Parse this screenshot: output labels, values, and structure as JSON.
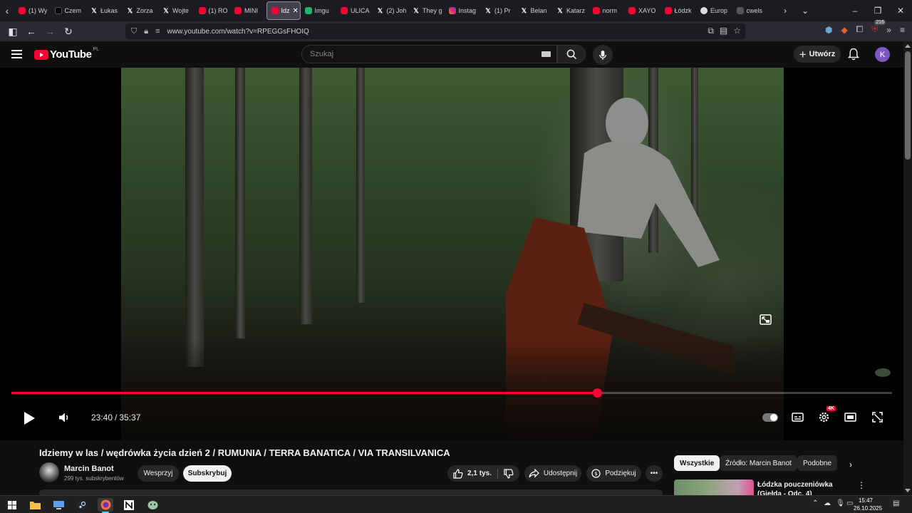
{
  "browser": {
    "tabs": [
      {
        "label": "(1) Wy",
        "favicon": "youtube-icon",
        "active": false
      },
      {
        "label": "Czem",
        "favicon": "tiktok-icon",
        "active": false
      },
      {
        "label": "Łukas",
        "favicon": "x-icon",
        "active": false
      },
      {
        "label": "Zorza",
        "favicon": "x-icon",
        "active": false
      },
      {
        "label": "Wojte",
        "favicon": "x-icon",
        "active": false
      },
      {
        "label": "(1) RO",
        "favicon": "youtube-icon",
        "active": false
      },
      {
        "label": "MINI",
        "favicon": "youtube-icon",
        "active": false
      },
      {
        "label": "Idz",
        "favicon": "youtube-icon",
        "active": true
      },
      {
        "label": "Imgu",
        "favicon": "imgur-icon",
        "active": false
      },
      {
        "label": "ULICA",
        "favicon": "youtube-icon",
        "active": false
      },
      {
        "label": "(2) Joh",
        "favicon": "x-icon",
        "active": false
      },
      {
        "label": "They g",
        "favicon": "x-icon",
        "active": false
      },
      {
        "label": "Instag",
        "favicon": "instagram-icon",
        "active": false
      },
      {
        "label": "(1) Pr",
        "favicon": "x-icon",
        "active": false
      },
      {
        "label": "Belan",
        "favicon": "x-icon",
        "active": false
      },
      {
        "label": "Katarz",
        "favicon": "x-icon",
        "active": false
      },
      {
        "label": "norm",
        "favicon": "youtube-icon",
        "active": false
      },
      {
        "label": "XAYO",
        "favicon": "youtube-icon",
        "active": false
      },
      {
        "label": "Łódzk",
        "favicon": "youtube-icon",
        "active": false
      },
      {
        "label": "Europ",
        "favicon": "globe-icon",
        "active": false
      },
      {
        "label": "cwels",
        "favicon": "page-icon",
        "active": false
      }
    ],
    "url": "www.youtube.com/watch?v=RPEGGsFHOIQ",
    "extension_badge": "216"
  },
  "youtube": {
    "logo_text": "YouTube",
    "country_code": "PL",
    "search_placeholder": "Szukaj",
    "create_label": "Utwórz",
    "avatar_letter": "K",
    "accent_color": "#ff0033"
  },
  "player": {
    "current_time": "23:40",
    "duration": "35:37",
    "time_separator": "/",
    "progress_fraction": 0.665,
    "quality_badge": "4K"
  },
  "video": {
    "title": "Idziemy w las / wędrówka życia dzień 2 / RUMUNIA / TERRA BANATICA / VIA TRANSILVANICA",
    "channel_name": "Marcin Banot",
    "subscribers": "299 tys. subskrybentów",
    "support_label": "Wesprzyj",
    "subscribe_label": "Subskrybuj",
    "likes": "2,1 tys.",
    "share_label": "Udostępnij",
    "thanks_label": "Podziękuj"
  },
  "sidebar": {
    "chips": [
      "Wszystkie",
      "Źródło: Marcin Banot",
      "Podobne"
    ],
    "recommendation_title": "Łódzka pouczeniówka (Giełda - Odc. 4)"
  },
  "taskbar": {
    "time": "15:47",
    "date": "26.10.2025"
  }
}
